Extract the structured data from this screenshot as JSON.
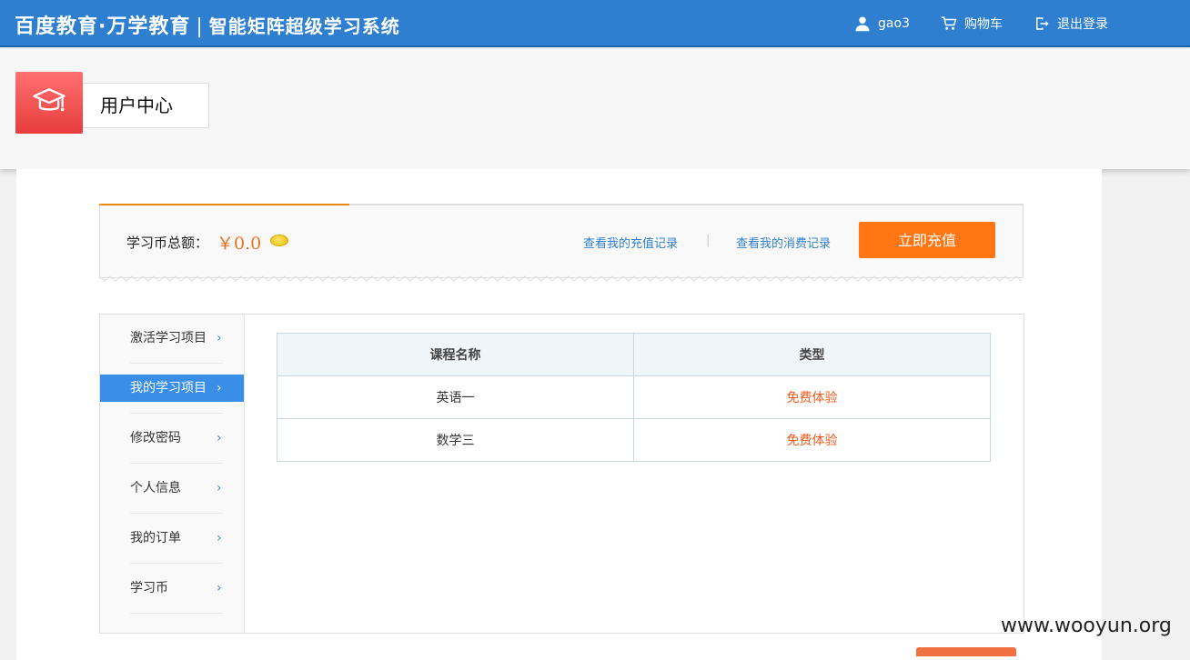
{
  "topbar": {
    "brand_main": "百度教育·万学教育",
    "brand_sep": "|",
    "brand_sub": "智能矩阵超级学习系统",
    "user": "gao3",
    "cart": "购物车",
    "logout": "退出登录"
  },
  "header": {
    "title": "用户中心"
  },
  "coin": {
    "label": "学习币总额：",
    "amount": "￥0.0",
    "link_recharge_records": "查看我的充值记录",
    "divider": "|",
    "link_spend_records": "查看我的消费记录",
    "recharge_button": "立即充值"
  },
  "sidebar": {
    "items": [
      {
        "label": "激活学习项目"
      },
      {
        "label": "我的学习项目"
      },
      {
        "label": "修改密码"
      },
      {
        "label": "个人信息"
      },
      {
        "label": "我的订单"
      },
      {
        "label": "学习币"
      }
    ],
    "active_index": 1,
    "chevron": "›"
  },
  "table": {
    "headers": [
      "课程名称",
      "类型"
    ],
    "rows": [
      [
        "英语一",
        "免费体验"
      ],
      [
        "数学三",
        "免费体验"
      ]
    ]
  },
  "watermark": "www.wooyun.org",
  "colors": {
    "topbar": "#2f7fd0",
    "accent_orange": "#ff7613",
    "active_blue": "#3a8ee6",
    "type_red": "#f05a1a"
  }
}
